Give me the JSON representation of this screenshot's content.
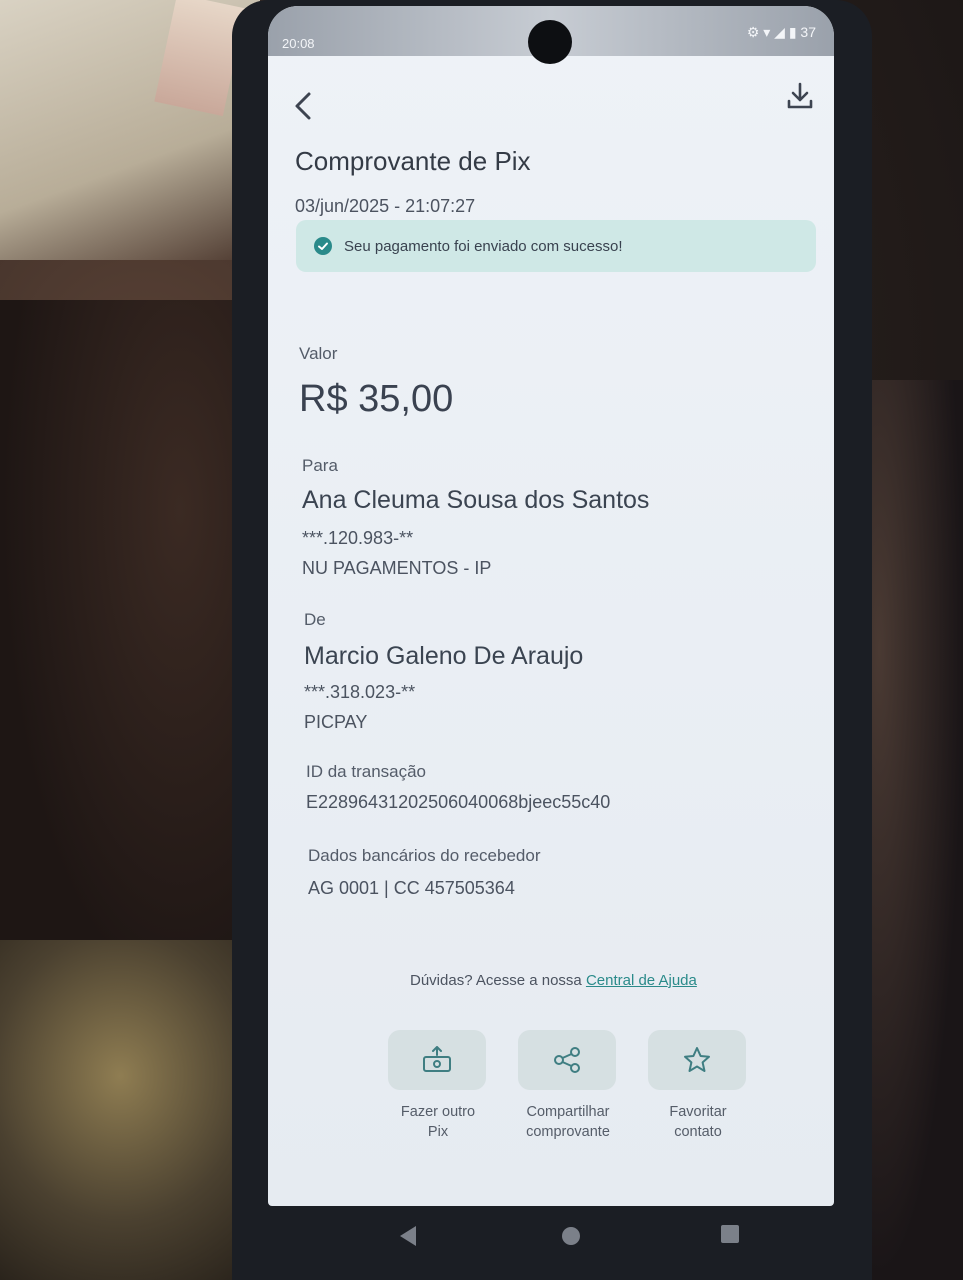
{
  "status_bar": {
    "time": "20:08",
    "indicators": "⚙ ▾ ◢ ▮ 37"
  },
  "header": {
    "title": "Comprovante de Pix",
    "datetime": "03/jun/2025 - 21:07:27"
  },
  "banner": {
    "message": "Seu pagamento foi enviado com sucesso!",
    "color": "#cfe8e6"
  },
  "amount": {
    "label": "Valor",
    "value": "R$ 35,00"
  },
  "recipient": {
    "label": "Para",
    "name": "Ana Cleuma Sousa dos Santos",
    "document": "***.120.983-**",
    "institution": "NU PAGAMENTOS - IP"
  },
  "sender": {
    "label": "De",
    "name": "Marcio Galeno De Araujo",
    "document": "***.318.023-**",
    "institution": "PICPAY"
  },
  "transaction": {
    "label": "ID da transação",
    "id": "E22896431202506040068bjeec55c40"
  },
  "bank_details": {
    "label": "Dados bancários do recebedor",
    "value": "AG 0001 | CC 457505364"
  },
  "help": {
    "prefix": "Dúvidas? Acesse a nossa ",
    "link": "Central de Ajuda"
  },
  "actions": [
    {
      "label": "Fazer outro\nPix",
      "icon": "send-money-icon"
    },
    {
      "label": "Compartilhar\ncomprovante",
      "icon": "share-icon"
    },
    {
      "label": "Favoritar\ncontato",
      "icon": "star-icon"
    }
  ],
  "colors": {
    "accent": "#2a8a8a",
    "text": "#3b4451"
  }
}
